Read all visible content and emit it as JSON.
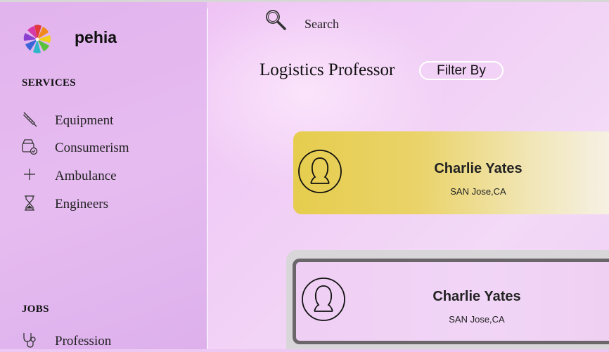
{
  "brand": {
    "name": "pehia"
  },
  "search": {
    "label": "Search"
  },
  "sidebar": {
    "services_title": "SERVICES",
    "services": [
      {
        "label": "Equipment",
        "icon": "syringe-icon"
      },
      {
        "label": "Consumerism",
        "icon": "cart-check-icon"
      },
      {
        "label": "Ambulance",
        "icon": "plus-icon"
      },
      {
        "label": "Engineers",
        "icon": "hourglass-icon"
      }
    ],
    "jobs_title": "JOBS",
    "jobs": [
      {
        "label": "Profession",
        "icon": "stethoscope-icon"
      }
    ]
  },
  "main": {
    "title": "Logistics Professor",
    "filter_label": "Filter By",
    "cards": [
      {
        "name": "Charlie Yates",
        "location": "SAN Jose,CA"
      },
      {
        "name": "Charlie Yates",
        "location": "SAN Jose,CA"
      }
    ]
  },
  "colors": {
    "sidebar_bg": "#e2b3ee",
    "card_highlight": "#e6cd4e",
    "card_border": "#6a666a"
  }
}
